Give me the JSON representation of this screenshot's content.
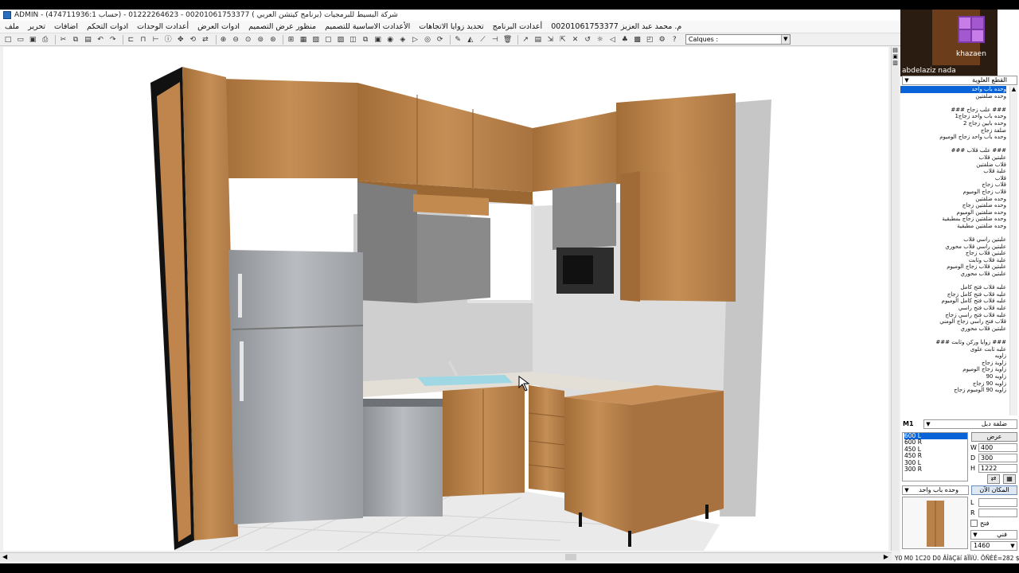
{
  "window": {
    "title": "ADMIN - شركة البسيط للبرمجيات (برنامج كيتشن العربي ) 00201061753377 - 01222264623 - (حساب 474711936:1)"
  },
  "menu": [
    "ملف",
    "تحرير",
    "اضافات",
    "ادوات التحكم",
    "أعدادت الوحدات",
    "ادوات العرض",
    "منظور عرض التصميم",
    "الأعدادت الاساسية للتصميم",
    "تحديد زوايا الاتجاهات",
    "أعدادت البرنامج",
    "م. محمد عبد العزيز 00201061753377"
  ],
  "toolbar": {
    "calques_label": "Calques :"
  },
  "webcam": {
    "name": "abdelaziz nada",
    "logo": "khazaen"
  },
  "panel": {
    "top_dropdown": "القطع العلوية",
    "items": [
      {
        "label": "وحده باب واحد",
        "selected": true
      },
      {
        "label": "وحده ضلفتين"
      },
      {
        "gap": true
      },
      {
        "label": "### علب زجاج ###"
      },
      {
        "label": "وحده باب واحد زجاج1"
      },
      {
        "label": "وحده بابين زجاج 2"
      },
      {
        "label": "ضلفة زجاج"
      },
      {
        "label": "وحده باب واحد زجاج الوميوم"
      },
      {
        "gap": true
      },
      {
        "label": "### علب قلاب ###"
      },
      {
        "label": "علبتين قلاب"
      },
      {
        "label": "قلاب ضلفتين"
      },
      {
        "label": "علبة قلاب"
      },
      {
        "label": "قلاب"
      },
      {
        "label": "قلاب زجاج"
      },
      {
        "label": "قلاب زجاج الوميوم"
      },
      {
        "label": "وحده ضلفتين"
      },
      {
        "label": "وحده ضلفتين زجاج"
      },
      {
        "label": "وحده ضلفتين الوميوم"
      },
      {
        "label": "وحده ضلفتين زجاج بمطبقية"
      },
      {
        "label": "وحده ضلفتين مطبقية"
      },
      {
        "gap": true
      },
      {
        "label": "علبتين راسي قلاب"
      },
      {
        "label": "علبتين راسي قلاب محوري"
      },
      {
        "label": "علبتين قلاب زجاج"
      },
      {
        "label": "علبة قلاب وثابت"
      },
      {
        "label": "علبتين قلاب زجاج الوميوم"
      },
      {
        "label": "علبتين قلاب محوري"
      },
      {
        "gap": true
      },
      {
        "label": "علبه قلاب فتح كامل"
      },
      {
        "label": "علبه قلاب فتح كامل زجاج"
      },
      {
        "label": "علبه قلاب فتح كامل الوميوم"
      },
      {
        "label": "علبه قلاب فتح راسي"
      },
      {
        "label": "علبه قلاب فتح راسي زجاج"
      },
      {
        "label": "قلاب فتح راسي زجاج الومني"
      },
      {
        "label": "علبتين قلاب محوري"
      },
      {
        "gap": true
      },
      {
        "label": "### زوايا وركن وثابت ###"
      },
      {
        "label": "علبه ثابت علوى"
      },
      {
        "label": "زاويه"
      },
      {
        "label": "زاوية زجاج"
      },
      {
        "label": "زاوية زجاج الوميوم"
      },
      {
        "label": "زاويه 90"
      },
      {
        "label": "زاويه 90 زجاج"
      },
      {
        "label": "زاويه 90 الوميوم زجاج"
      }
    ],
    "m1_label": "M1",
    "part_dropdown": "ضلفة دبل",
    "width_btn": "عرض",
    "sizes": [
      "600 L",
      "600 R",
      "450 L",
      "450 R",
      "300 L",
      "300 R"
    ],
    "dims": {
      "W": "400",
      "D": "300",
      "H": "1222"
    },
    "unit_dropdown": "وحده باب واحد",
    "place_btn": "المكان الآن",
    "l_label": "L",
    "r_label": "R",
    "open_label": "فتح",
    "bottom_dropdown": "فني",
    "bottom_value": "1460"
  },
  "status": {
    "text": "Y0 M0 1C20 D0 ÂÎãÇäí ãÏÏíÚ. ÕÑÈÉ=282 $"
  },
  "colors": {
    "wood": "#b9824a",
    "selection": "#0a64d8"
  }
}
